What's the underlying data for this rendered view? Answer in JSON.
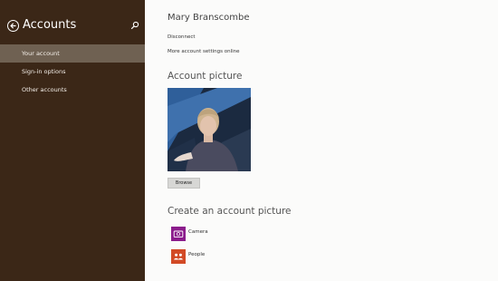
{
  "sidebar": {
    "title": "Accounts",
    "items": [
      {
        "label": "Your account",
        "selected": true
      },
      {
        "label": "Sign-in options",
        "selected": false
      },
      {
        "label": "Other accounts",
        "selected": false
      }
    ],
    "back_icon": "back-arrow-icon",
    "search_icon": "search-icon"
  },
  "main": {
    "user_name": "Mary Branscombe",
    "disconnect_label": "Disconnect",
    "more_settings_label": "More account settings online",
    "account_picture_heading": "Account picture",
    "browse_label": "Browse",
    "create_heading": "Create an account picture",
    "apps": [
      {
        "label": "Camera",
        "icon": "camera-icon",
        "color": "#8b1c8c"
      },
      {
        "label": "People",
        "icon": "people-icon",
        "color": "#d24a26"
      }
    ]
  },
  "colors": {
    "sidebar_bg": "#3b2717",
    "sidebar_selected_bg": "#6f6152",
    "content_bg": "#fbfbfa"
  }
}
